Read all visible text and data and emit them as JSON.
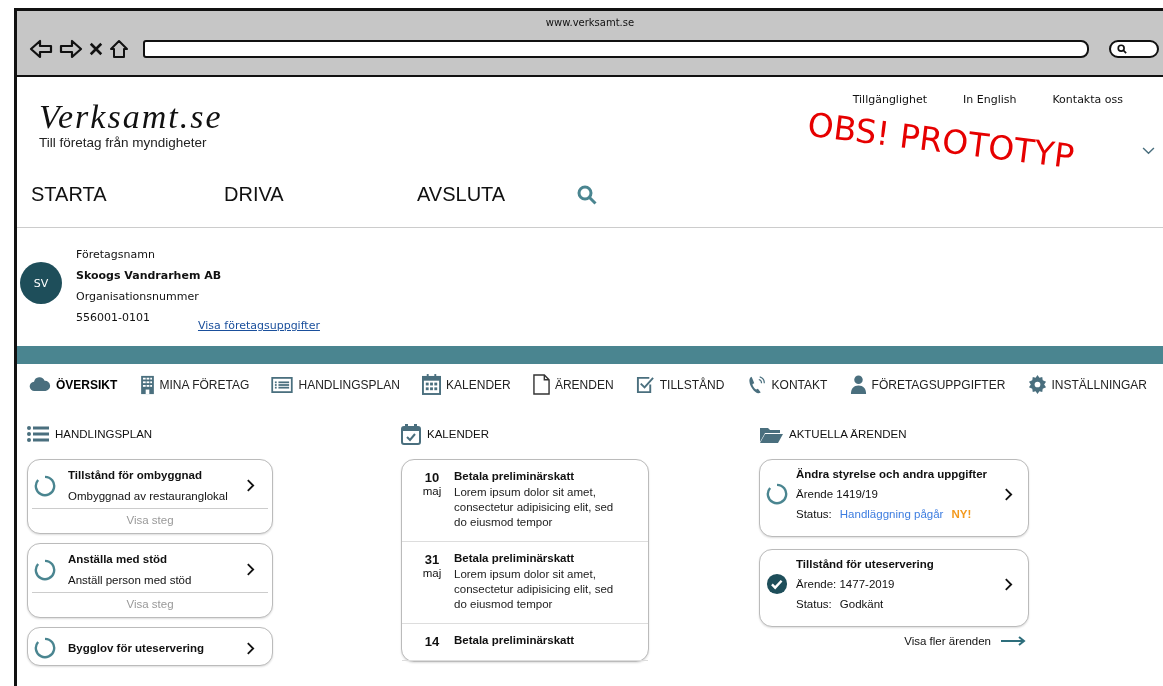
{
  "browser": {
    "url": "www.verksamt.se"
  },
  "stamp": "OBS! PROTOTYP",
  "header": {
    "logo": "Verksamt.se",
    "tagline": "Till företag från myndigheter",
    "top_links": [
      "Tillgänglighet",
      "In English",
      "Kontakta oss"
    ],
    "nav": [
      "STARTA",
      "DRIVA",
      "AVSLUTA"
    ]
  },
  "company": {
    "initials": "SV",
    "name_label": "Företagsnamn",
    "name": "Skoogs Vandrarhem AB",
    "org_label": "Organisationsnummer",
    "org_number": "556001-0101",
    "details_link": "Visa företagsuppgifter"
  },
  "tabs": [
    {
      "label": "ÖVERSIKT",
      "selected": true
    },
    {
      "label": "MINA FÖRETAG",
      "selected": false
    },
    {
      "label": "HANDLINGSPLAN",
      "selected": false
    },
    {
      "label": "KALENDER",
      "selected": false
    },
    {
      "label": "ÄRENDEN",
      "selected": false
    },
    {
      "label": "TILLSTÅND",
      "selected": false
    },
    {
      "label": "KONTAKT",
      "selected": false
    },
    {
      "label": "FÖRETAGSUPPGIFTER",
      "selected": false
    },
    {
      "label": "INSTÄLLNINGAR",
      "selected": false
    }
  ],
  "plan": {
    "title": "HANDLINGSPLAN",
    "items": [
      {
        "title": "Tillstånd för ombyggnad",
        "subtitle": "Ombyggnad av restauranglokal",
        "action": "Visa steg"
      },
      {
        "title": "Anställa med stöd",
        "subtitle": "Anställ person med stöd",
        "action": "Visa steg"
      },
      {
        "title": "Bygglov för uteservering"
      }
    ]
  },
  "calendar": {
    "title": "KALENDER",
    "events": [
      {
        "day": "10",
        "month": "maj",
        "title": "Betala preliminärskatt",
        "text": "Lorem ipsum dolor sit amet, consectetur adipisicing elit, sed do eiusmod tempor"
      },
      {
        "day": "31",
        "month": "maj",
        "title": "Betala preliminärskatt",
        "text": "Lorem ipsum dolor sit amet, consectetur adipisicing elit, sed do eiusmod tempor"
      },
      {
        "day": "14",
        "title": "Betala preliminärskatt"
      }
    ]
  },
  "cases": {
    "title": "AKTUELLA ÄRENDEN",
    "items": [
      {
        "title": "Ändra styrelse och andra uppgifter",
        "number": "Ärende 1419/19",
        "status_label": "Status:",
        "status": "Handläggning pågår",
        "badge": "NY!",
        "kind": "in_progress"
      },
      {
        "title": "Tillstånd för uteservering",
        "number": "Ärende: 1477-2019",
        "status_label": "Status:",
        "status": "Godkänt",
        "kind": "approved"
      }
    ],
    "more_link": "Visa fler ärenden"
  }
}
